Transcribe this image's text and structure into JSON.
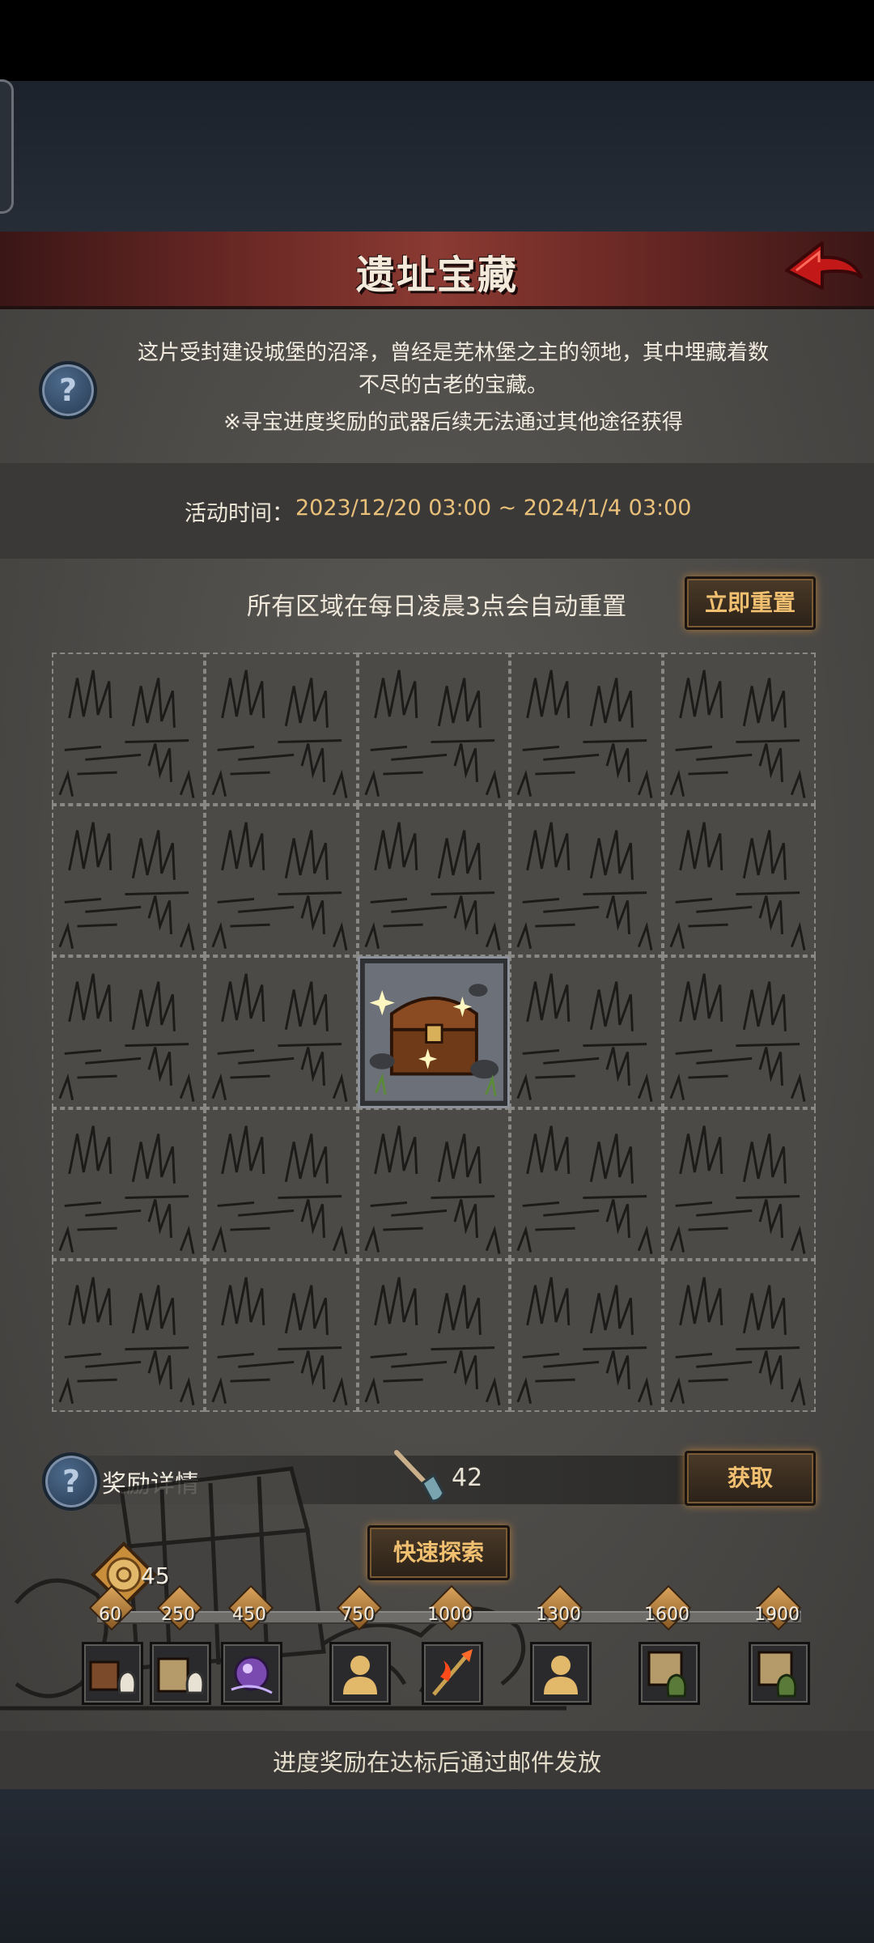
{
  "header": {
    "title": "遗址宝藏",
    "back_icon": "back-arrow-icon"
  },
  "intro": {
    "text_line1": "这片受封建设城堡的沼泽，曾经是芜林堡之主的领地，其中埋藏着数",
    "text_line2": "不尽的古老的宝藏。",
    "note": "※寻宝进度奖励的武器后续无法通过其他途径获得",
    "help_symbol": "?"
  },
  "event_time": {
    "label": "活动时间：",
    "value": "2023/12/20 03:00 ~ 2024/1/4 03:00"
  },
  "reset": {
    "note": "所有区域在每日凌晨3点会自动重置",
    "button_label": "立即重置"
  },
  "grid": {
    "rows": 5,
    "cols": 5,
    "opened_cell": {
      "row": 3,
      "col": 3,
      "content": "treasure-chest"
    }
  },
  "rewards": {
    "label": "奖励详情",
    "shovel_count": "42",
    "get_button": "获取",
    "help_symbol": "?"
  },
  "explore": {
    "button_label": "快速探索",
    "progress_value": "45"
  },
  "milestones": [
    {
      "value": "60",
      "reward": "crate-and-bag"
    },
    {
      "value": "250",
      "reward": "chest-and-bag"
    },
    {
      "value": "450",
      "reward": "purple-orb"
    },
    {
      "value": "750",
      "reward": "unknown-character"
    },
    {
      "value": "1000",
      "reward": "flame-spear"
    },
    {
      "value": "1300",
      "reward": "unknown-character"
    },
    {
      "value": "1600",
      "reward": "chest-and-green-bag"
    },
    {
      "value": "1900",
      "reward": "chest-and-green-bag"
    }
  ],
  "footer": {
    "text": "进度奖励在达标后通过邮件发放"
  },
  "colors": {
    "accent_gold": "#e9c07a",
    "title_bar": "#8a3a32",
    "panel": "#4c4a47"
  }
}
